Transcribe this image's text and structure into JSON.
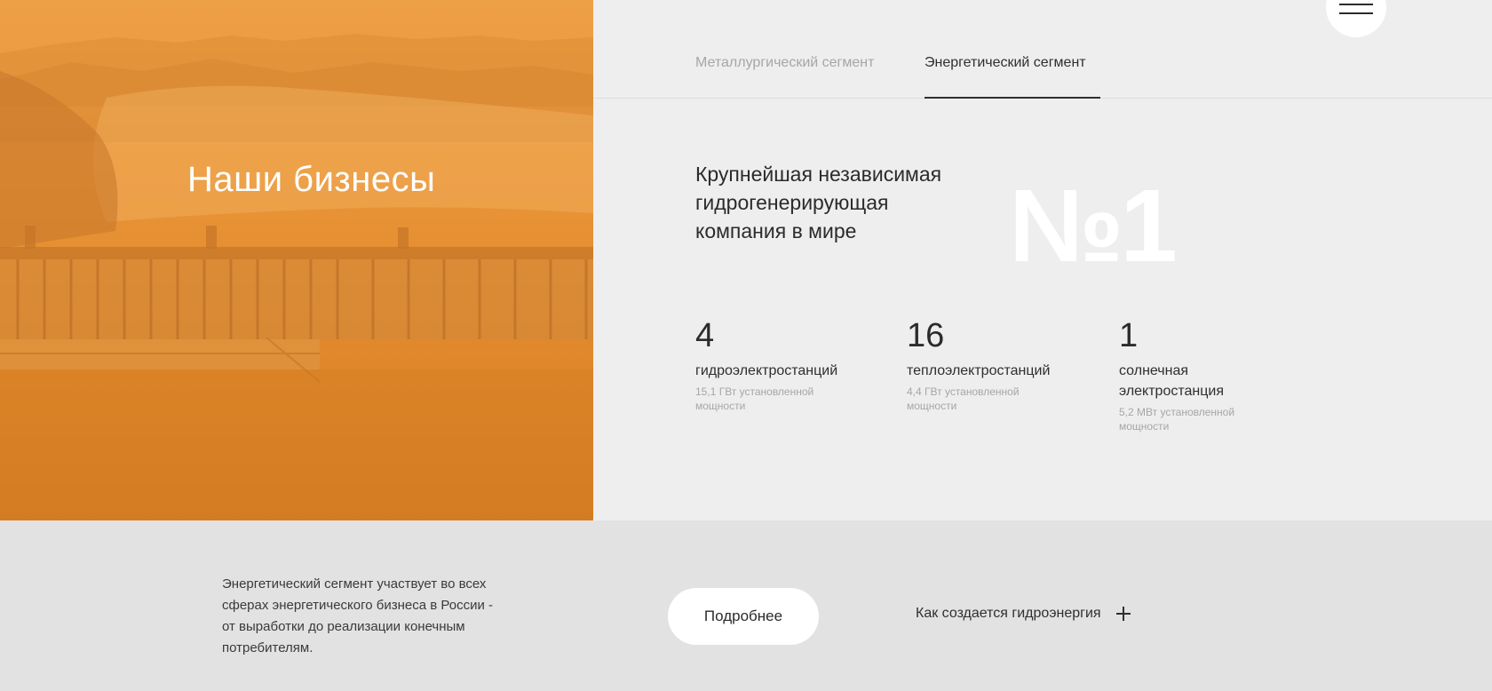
{
  "hero": {
    "title": "Наши бизнесы",
    "overlay_color": "#e8922f"
  },
  "tabs": [
    {
      "label": "Металлургический сегмент",
      "active": false
    },
    {
      "label": "Энергетический сегмент",
      "active": true
    }
  ],
  "menu": {
    "icon": "hamburger-icon"
  },
  "headline": "Крупнейшая независимая гидрогенерирующая компания в мире",
  "big_number": "№1",
  "stats": [
    {
      "value": "4",
      "label": "гидроэлектростанций",
      "sub": "15,1 ГВт установленной мощности"
    },
    {
      "value": "16",
      "label": "теплоэлектростанций",
      "sub": "4,4 ГВт установленной мощности"
    },
    {
      "value": "1",
      "label": "солнечная электростанция",
      "sub": "5,2 МВт установленной мощности"
    }
  ],
  "bottom": {
    "description": "Энергетический сегмент участвует во всех сферах энергетического бизнеса в России - от выработки до реализации конечным потребителям.",
    "more_button": "Подробнее",
    "hydro_link": "Как создается гидроэнергия",
    "hydro_icon": "plus-icon"
  },
  "colors": {
    "accent_orange": "#e8922f",
    "panel_bg": "#eeeeee",
    "bottom_bg": "#e3e2e2",
    "text": "#2b2b2b",
    "muted": "#a6a6a6"
  }
}
